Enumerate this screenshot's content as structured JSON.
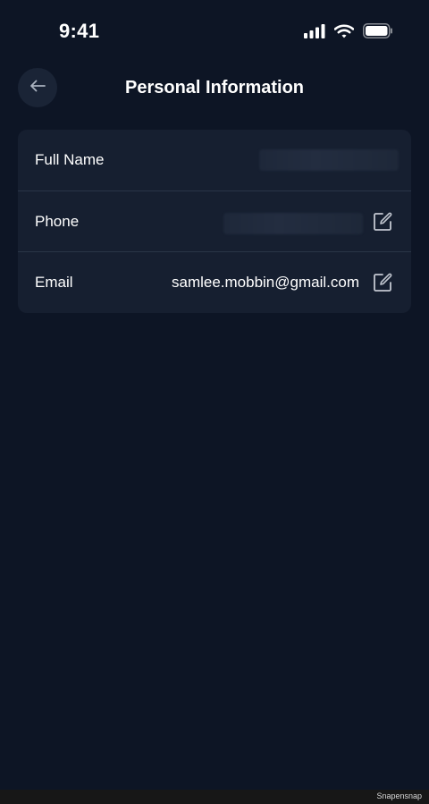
{
  "status_bar": {
    "time": "9:41",
    "icons": [
      "signal-icon",
      "wifi-icon",
      "battery-icon"
    ]
  },
  "header": {
    "title": "Personal Information",
    "back_icon": "arrow-left-icon"
  },
  "rows": [
    {
      "label": "Full Name",
      "value": "",
      "editable": false,
      "value_obscured": true
    },
    {
      "label": "Phone",
      "value": "",
      "editable": true,
      "value_obscured": true
    },
    {
      "label": "Email",
      "value": "samlee.mobbin@gmail.com",
      "editable": true,
      "value_obscured": false
    }
  ],
  "colors": {
    "background": "#0d1525",
    "card": "#161f30",
    "divider": "#2a3547",
    "icon": "#c3c8d1"
  },
  "watermark": "Snapensnap"
}
